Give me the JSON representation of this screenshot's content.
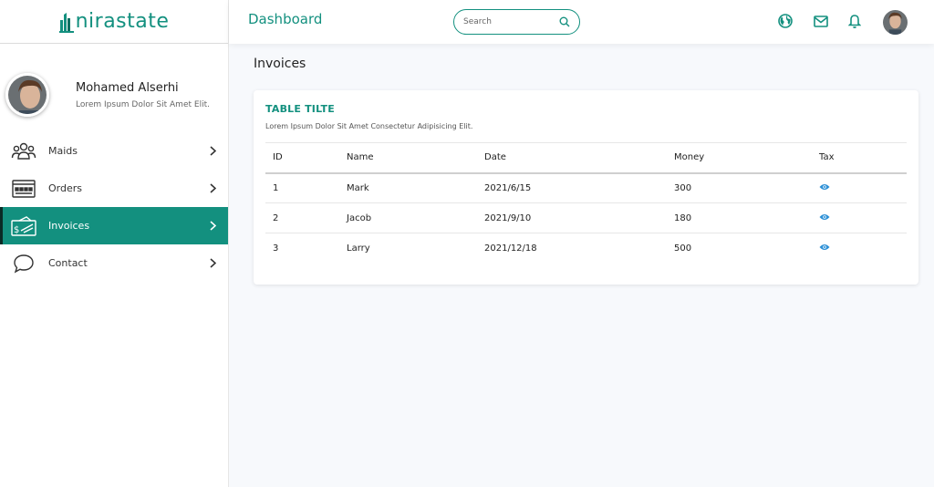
{
  "app": {
    "logo_text": "nirastate"
  },
  "sidebar": {
    "profile": {
      "name": "Mohamed Alserhi",
      "subtitle": "Lorem Ipsum Dolor Sit Amet Elit."
    },
    "items": [
      {
        "label": "Maids",
        "icon": "people-icon",
        "active": false
      },
      {
        "label": "Orders",
        "icon": "orders-icon",
        "active": false
      },
      {
        "label": "Invoices",
        "icon": "invoice-icon",
        "active": true
      },
      {
        "label": "Contact",
        "icon": "chat-bubble-icon",
        "active": false
      }
    ]
  },
  "topbar": {
    "title": "Dashboard",
    "search_placeholder": "Search",
    "icons": [
      "globe-icon",
      "mail-icon",
      "bell-icon"
    ]
  },
  "main": {
    "page_title": "Invoices",
    "card": {
      "title": "TABLE TILTE",
      "subtitle": "Lorem Ipsum Dolor Sit Amet Consectetur Adipisicing Elit.",
      "columns": [
        "ID",
        "Name",
        "Date",
        "Money",
        "Tax"
      ],
      "rows": [
        {
          "id": "1",
          "name": "Mark",
          "date": "2021/6/15",
          "money": "300",
          "tax_icon": "eye-icon"
        },
        {
          "id": "2",
          "name": "Jacob",
          "date": "2021/9/10",
          "money": "180",
          "tax_icon": "eye-icon"
        },
        {
          "id": "3",
          "name": "Larry",
          "date": "2021/12/18",
          "money": "500",
          "tax_icon": "eye-icon"
        }
      ]
    }
  },
  "colors": {
    "accent": "#13907f",
    "background": "#f7f9fc",
    "eye_icon": "#2b8fd6"
  }
}
